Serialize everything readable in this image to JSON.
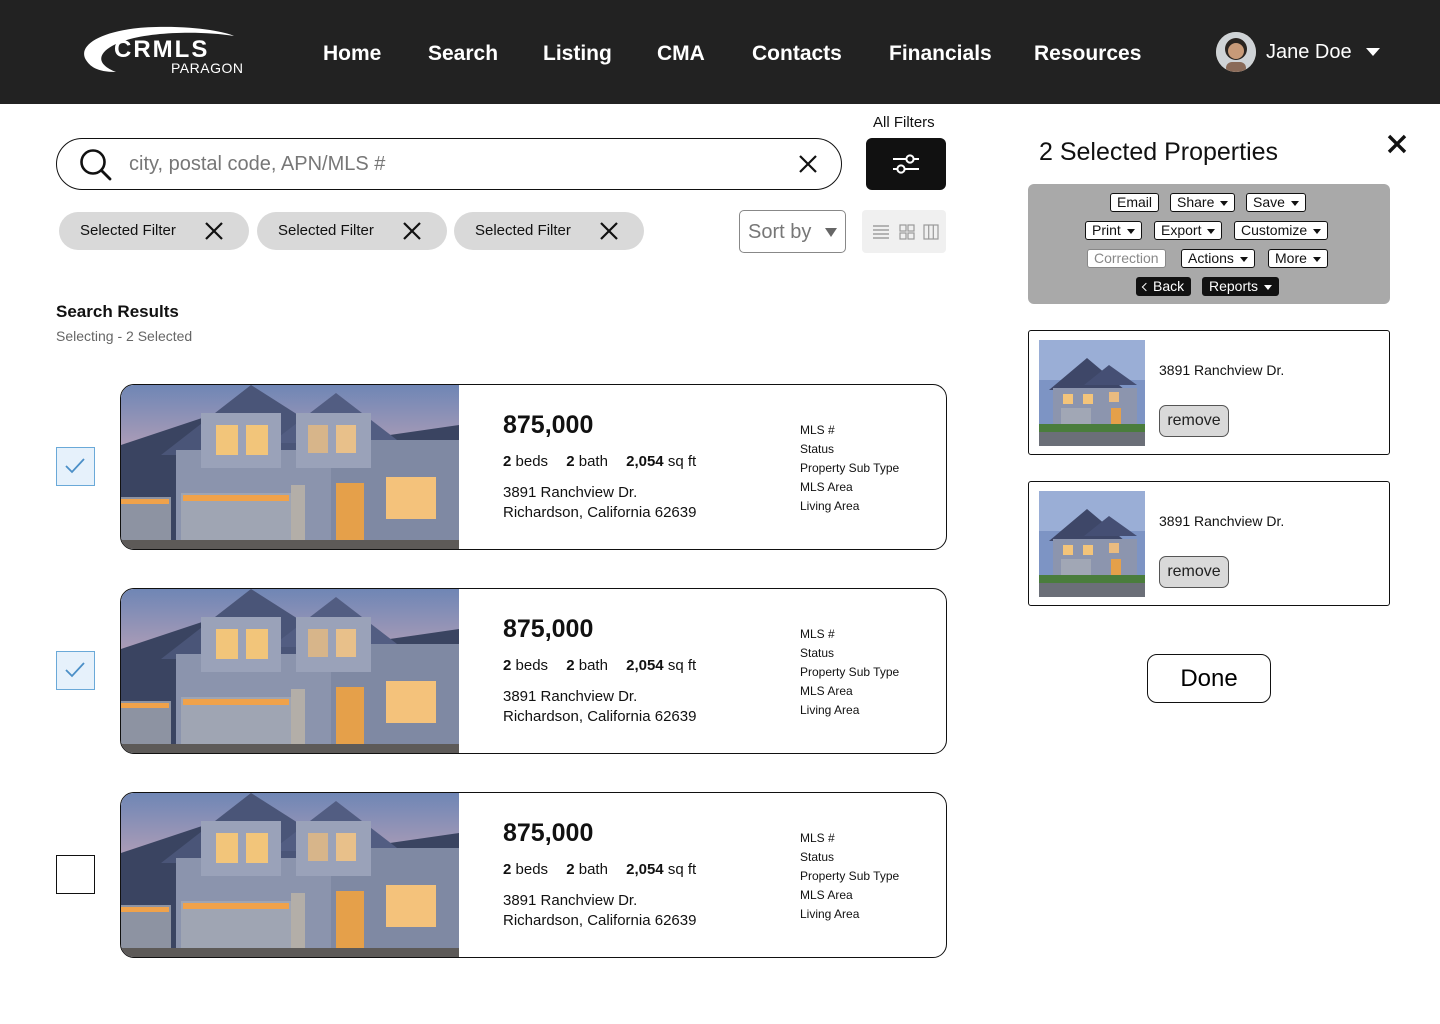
{
  "header": {
    "logo_top": "CRMLS",
    "logo_bottom": "PARAGON",
    "nav": [
      "Home",
      "Search",
      "Listing",
      "CMA",
      "Contacts",
      "Financials",
      "Resources"
    ],
    "user_name": "Jane Doe"
  },
  "search": {
    "placeholder": "city, postal code, APN/MLS #",
    "all_filters_label": "All Filters"
  },
  "chips": [
    "Selected Filter",
    "Selected Filter",
    "Selected Filter"
  ],
  "sort_label": "Sort by",
  "results": {
    "title": "Search Results",
    "subtitle": "Selecting - 2 Selected",
    "items": [
      {
        "checked": true,
        "price": "875,000",
        "beds": "2",
        "beds_label": "beds",
        "baths": "2",
        "baths_label": "bath",
        "sqft": "2,054",
        "sqft_label": "sq ft",
        "address1": "3891 Ranchview Dr.",
        "address2": "Richardson, California 62639",
        "meta": [
          "MLS #",
          "Status",
          "Property Sub Type",
          "MLS Area",
          "Living Area"
        ]
      },
      {
        "checked": true,
        "price": "875,000",
        "beds": "2",
        "beds_label": "beds",
        "baths": "2",
        "baths_label": "bath",
        "sqft": "2,054",
        "sqft_label": "sq ft",
        "address1": "3891 Ranchview Dr.",
        "address2": "Richardson, California 62639",
        "meta": [
          "MLS #",
          "Status",
          "Property Sub Type",
          "MLS Area",
          "Living Area"
        ]
      },
      {
        "checked": false,
        "price": "875,000",
        "beds": "2",
        "beds_label": "beds",
        "baths": "2",
        "baths_label": "bath",
        "sqft": "2,054",
        "sqft_label": "sq ft",
        "address1": "3891 Ranchview Dr.",
        "address2": "Richardson, California 62639",
        "meta": [
          "MLS #",
          "Status",
          "Property Sub Type",
          "MLS Area",
          "Living Area"
        ]
      }
    ]
  },
  "panel": {
    "title": "2 Selected Properties",
    "toolbar": {
      "email": "Email",
      "share": "Share",
      "save": "Save",
      "print": "Print",
      "export": "Export",
      "customize": "Customize",
      "correction": "Correction",
      "actions": "Actions",
      "more": "More",
      "back": "Back",
      "reports": "Reports"
    },
    "selected": [
      {
        "address": "3891 Ranchview Dr.",
        "remove_label": "remove"
      },
      {
        "address": "3891 Ranchview Dr.",
        "remove_label": "remove"
      }
    ],
    "done_label": "Done"
  },
  "colors": {
    "header_bg": "#222222",
    "checked_border": "#6aa9d8",
    "toolbar_bg": "#a9a9a9"
  }
}
